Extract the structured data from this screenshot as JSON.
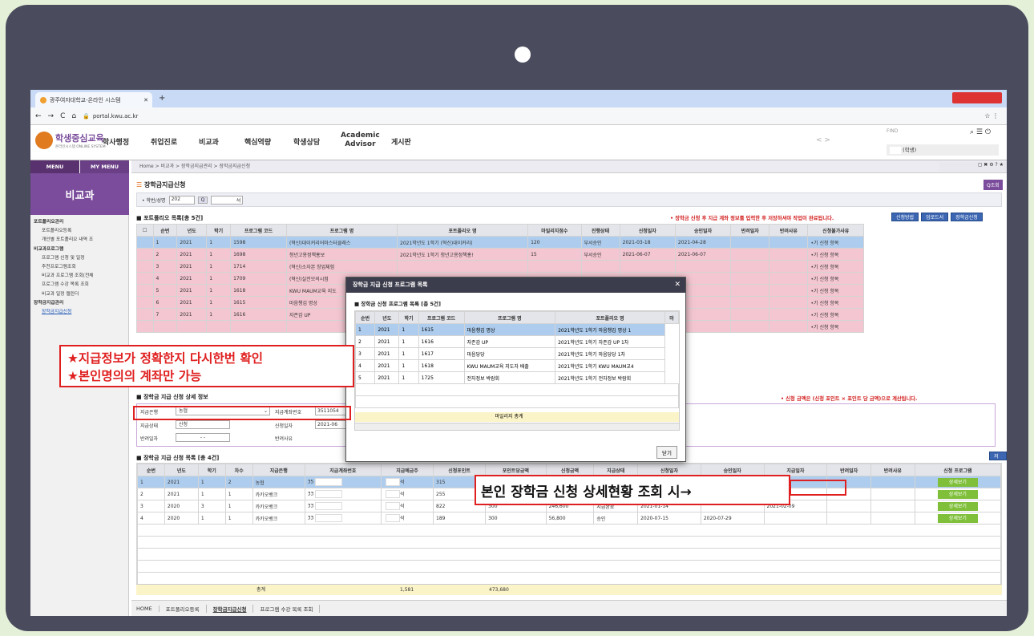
{
  "browser": {
    "tab_title": "광주여자대학교-온라인 시스템",
    "url": "portal.kwu.ac.kr"
  },
  "header": {
    "logo_main": "학생중심교육",
    "logo_sub": "온라인시스템 ONLINE SYSTEM",
    "nav": [
      "학사행정",
      "취업진로",
      "비교과",
      "핵심역량",
      "학생상담",
      "Academic",
      "Advisor",
      "게시판"
    ],
    "find_label": "FIND",
    "user": "(학생)"
  },
  "sidebar": {
    "tab_menu": "MENU",
    "tab_mymenu": "MY MENU",
    "title": "비교과",
    "items": [
      {
        "label": "포트폴리오관리",
        "g": true
      },
      {
        "label": "포트폴리오등록"
      },
      {
        "label": "개인별 포트폴리오 내역 조"
      },
      {
        "label": "비교과프로그램",
        "g": true
      },
      {
        "label": "프로그램 신청 및 일정"
      },
      {
        "label": "추천프로그램조회"
      },
      {
        "label": "비교과 프로그램 조회(전체"
      },
      {
        "label": "프로그램 수강 목록 조회"
      },
      {
        "label": "비교과 일정 캘린더"
      },
      {
        "label": "장학금지급관리",
        "g": true
      },
      {
        "label": "장학금지급신청",
        "sel": true
      }
    ]
  },
  "breadcrumb": "Home > 비교과 > 장학금지급관리 > 장학금지급신청",
  "page_title": "장학금지급신청",
  "search": {
    "label": "• 학번/성명",
    "value": "202",
    "btn": "Q",
    "name_suffix": "석",
    "search_btn": "Q조회"
  },
  "portfolio": {
    "title": "포트폴리오 목록[총 5건]",
    "note": "• 장학금 신청 후 지급 계좌 정보를 입력한 후 저장하셔야 작업이 완료됩니다.",
    "buttons": [
      "신청방법",
      "업로드서",
      "장학금신청"
    ],
    "headers": [
      "순번",
      "년도",
      "학기",
      "프로그램 코드",
      "프로그램 명",
      "포트폴리오 명",
      "마일리지점수",
      "진행상태",
      "신청일자",
      "승인일자",
      "반려일자",
      "반려사유",
      "신청불가사유"
    ],
    "rows": [
      [
        "1",
        "2021",
        "1",
        "1598",
        "(혁신)대이커리어마스터클래스",
        "2021학년도 1학기 (혁신)대이커리(",
        "120",
        "부서승인",
        "2021-03-18",
        "2021-04-28",
        "",
        "",
        "•기 신청 항목"
      ],
      [
        "2",
        "2021",
        "1",
        "1698",
        "청년고용정책홍보",
        "2021학년도 1학기 청년고용정책홍!",
        "15",
        "부서승인",
        "2021-06-07",
        "2021-06-07",
        "",
        "",
        "•기 신청 항목"
      ],
      [
        "3",
        "2021",
        "1",
        "1714",
        "(혁신)소자본 창업체험",
        "",
        "",
        "",
        "",
        "",
        "",
        "",
        "•기 신청 항목"
      ],
      [
        "4",
        "2021",
        "1",
        "1709",
        "(혁신)실전모의시험",
        "",
        "",
        "",
        "",
        "",
        "",
        "",
        "•기 신청 항목"
      ],
      [
        "5",
        "2021",
        "1",
        "1618",
        "KWU MAUM교육 지도",
        "",
        "",
        "",
        "",
        "",
        "",
        "",
        "•기 신청 항목"
      ],
      [
        "6",
        "2021",
        "1",
        "1615",
        "마음챙김 명상",
        "",
        "",
        "",
        "",
        "",
        "",
        "",
        "•기 신청 항목"
      ],
      [
        "7",
        "2021",
        "1",
        "1616",
        "자존감 UP",
        "",
        "",
        "",
        "",
        "",
        "",
        "",
        "•기 신청 항목"
      ],
      [
        "",
        "",
        "",
        "",
        "",
        "",
        "",
        "",
        "",
        "",
        "",
        "",
        "•기 신청 항목"
      ]
    ]
  },
  "detail": {
    "title": "장학금 지급 신청 상세 정보",
    "bank_label": "지급은행",
    "bank_value": "농협",
    "account_label": "지급계좌번호",
    "account_value": "3511054",
    "status_label": "지급상태",
    "status_value": "신청",
    "applydate_label": "신청일자",
    "applydate_value": "2021-06",
    "reject_label": "반려일자",
    "reject_value": "- -",
    "reason_label": "반려사유",
    "note": "• 신청 금액은 (신청 포인트 × 포인트 당 금액)으로 계산됩니다."
  },
  "apply_list": {
    "title": "장학금 지급 신청 목록 [총 4건]",
    "save_btn": "저장",
    "headers": [
      "순번",
      "년도",
      "학기",
      "차수",
      "지급은행",
      "지급계좌번호",
      "지급예금주",
      "신청포인트",
      "포인트당금액",
      "신청금액",
      "지급상태",
      "신청일자",
      "승인일자",
      "지급일자",
      "반려일자",
      "반려사유",
      "신청 프로그램"
    ],
    "rows": [
      [
        "1",
        "2021",
        "1",
        "2",
        "농협",
        "35",
        "석",
        "315",
        "300",
        "",
        "",
        "",
        "",
        "",
        "",
        "",
        "상세보기"
      ],
      [
        "2",
        "2021",
        "1",
        "1",
        "카카오뱅크",
        "33",
        "석",
        "255",
        "300",
        "",
        "",
        "",
        "",
        "",
        "",
        "",
        "상세보기"
      ],
      [
        "3",
        "2020",
        "3",
        "1",
        "카카오뱅크",
        "33",
        "석",
        "822",
        "300",
        "246,600",
        "지급완료",
        "2021-01-14",
        "",
        "2021-02-09",
        "",
        "",
        "상세보기"
      ],
      [
        "4",
        "2020",
        "1",
        "1",
        "카카오뱅크",
        "33",
        "석",
        "189",
        "300",
        "56,800",
        "승인",
        "2020-07-15",
        "2020-07-29",
        "",
        "",
        "",
        "상세보기"
      ]
    ],
    "total_label": "총계",
    "total_points": "1,581",
    "total_amount": "473,680"
  },
  "modal": {
    "title": "장학금 지급 신청 프로그램 목록",
    "subtitle": "장학금 신청 프로그램 목록 [총 5건]",
    "headers": [
      "순번",
      "년도",
      "학기",
      "프로그램 코드",
      "프로그램 명",
      "포트폴리오 명",
      "마"
    ],
    "rows": [
      [
        "1",
        "2021",
        "1",
        "1615",
        "마음챙김 명상",
        "2021학년도 1학기 마음챙김 명상 1"
      ],
      [
        "2",
        "2021",
        "1",
        "1616",
        "자존감 UP",
        "2021학년도 1학기 자존감 UP 1차"
      ],
      [
        "3",
        "2021",
        "1",
        "1617",
        "마음당당",
        "2021학년도 1학기 마음당당 1차"
      ],
      [
        "4",
        "2021",
        "1",
        "1618",
        "KWU MAUM교육 지도자 배출",
        "2021학년도 1학기 KWU MAUM교4"
      ],
      [
        "5",
        "2021",
        "1",
        "1725",
        "전자정보 박람회",
        "2021학년도 1학기 전자정보 박람회"
      ]
    ],
    "footer": "마일리지 총계",
    "close_btn": "닫기"
  },
  "annotation1": {
    "line1": "★지급정보가 정확한지 다시한번 확인",
    "line2": "★본인명의의 계좌만 가능"
  },
  "annotation2": "본인 장학금 신청 상세현황 조회 시→",
  "bottom_tabs": [
    "HOME",
    "포트폴리오등록",
    "장학금지급신청",
    "프로그램 수강 목록 조회"
  ]
}
